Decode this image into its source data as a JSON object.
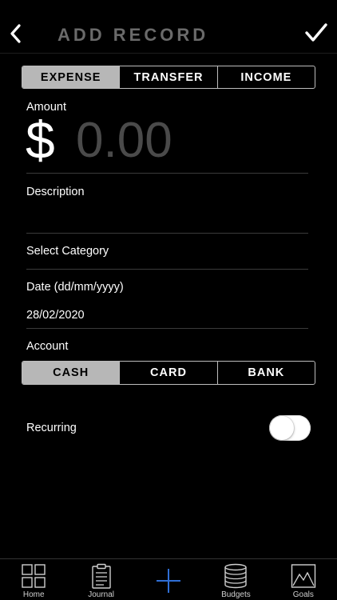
{
  "header": {
    "title": "ADD RECORD",
    "back_icon": "chevron-left-icon",
    "confirm_icon": "checkmark-icon"
  },
  "record_type": {
    "options": [
      "EXPENSE",
      "TRANSFER",
      "INCOME"
    ],
    "selected": "EXPENSE"
  },
  "amount": {
    "label": "Amount",
    "currency_symbol": "$",
    "placeholder": "0.00",
    "value": ""
  },
  "description": {
    "label": "Description",
    "value": ""
  },
  "category": {
    "label": "Select Category"
  },
  "date": {
    "label": "Date (dd/mm/yyyy)",
    "value": "28/02/2020"
  },
  "account": {
    "label": "Account",
    "options": [
      "CASH",
      "CARD",
      "BANK"
    ],
    "selected": "CASH"
  },
  "recurring": {
    "label": "Recurring",
    "enabled": false
  },
  "tabbar": {
    "items": [
      {
        "label": "Home",
        "icon": "grid-icon"
      },
      {
        "label": "Journal",
        "icon": "clipboard-icon"
      },
      {
        "label": "",
        "icon": "plus-icon"
      },
      {
        "label": "Budgets",
        "icon": "database-stack-icon"
      },
      {
        "label": "Goals",
        "icon": "mountain-picture-icon"
      }
    ]
  },
  "colors": {
    "background": "#000000",
    "title_gray": "#6a6a6a",
    "segment_active": "#b7b7b7",
    "plus_blue": "#2f6fd6",
    "divider": "#3a3a3a"
  }
}
